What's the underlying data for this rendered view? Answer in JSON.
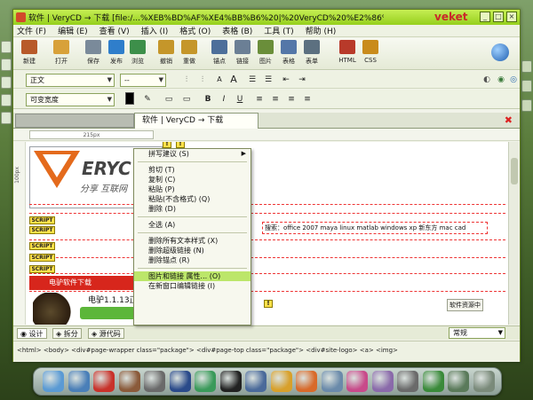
{
  "window": {
    "title": "软件 | VeryCD → 下载 [file:/...%XEB%BD%AF%XE4%BB%B6%20|%20VeryCD%20%E2%86%92%20%E4%B8%8B%...",
    "brand": "veket",
    "controls": {
      "minimize": "_",
      "maximize": "□",
      "close": "×"
    }
  },
  "menubar": {
    "items": [
      "文件 (F)",
      "编辑 (E)",
      "查看 (V)",
      "插入 (I)",
      "格式 (O)",
      "表格 (B)",
      "工具 (T)",
      "帮助 (H)"
    ]
  },
  "toolbar": {
    "buttons": [
      {
        "label": "新建",
        "icon": "new-file-icon",
        "color": "#b85a2a"
      },
      {
        "label": "打开",
        "icon": "open-folder-icon",
        "color": "#d8a13a"
      },
      {
        "label": "保存",
        "icon": "save-icon",
        "color": "#7a8a9a"
      },
      {
        "label": "发布",
        "icon": "publish-icon",
        "color": "#2f7ecb"
      },
      {
        "label": "浏览",
        "icon": "browse-icon",
        "color": "#3d8f4a"
      },
      {
        "label": "撤销",
        "icon": "undo-icon",
        "color": "#c5962a"
      },
      {
        "label": "重做",
        "icon": "redo-icon",
        "color": "#c5962a"
      },
      {
        "label": "锚点",
        "icon": "anchor-icon",
        "color": "#4d6f9a"
      },
      {
        "label": "链接",
        "icon": "link-icon",
        "color": "#6b7f95"
      },
      {
        "label": "图片",
        "icon": "image-icon",
        "color": "#6a8e3a"
      },
      {
        "label": "表格",
        "icon": "table-icon",
        "color": "#5477a8"
      },
      {
        "label": "表单",
        "icon": "form-icon",
        "color": "#5c7080"
      },
      {
        "label": "HTML",
        "icon": "html-icon",
        "color": "#b83a2a"
      },
      {
        "label": "CSS",
        "icon": "css-icon",
        "color": "#c98b1c"
      }
    ]
  },
  "format1": {
    "paragraph_style": "正文",
    "font_size": "--"
  },
  "format2": {
    "font_family": "可变宽度"
  },
  "tabs": {
    "active": "软件 | VeryCD → 下载"
  },
  "ruler": {
    "width_label": "215px"
  },
  "doc": {
    "vruler_label": "100px",
    "logo_text": "ERYC",
    "logo_sub": "分享  互联网",
    "script_tag": "SCRIPT",
    "tag_mark": "!",
    "redbar_text": "电驴软件下载",
    "hot_text": "搜索：office 2007 maya linux matlab windows xp 新东方 mac cad",
    "news_text": "电驴1.1.13正式版",
    "right_tag": "软件资源中"
  },
  "context_menu": {
    "items": [
      {
        "label": "拼写建议 (S)",
        "submenu": true
      },
      {
        "sep": true
      },
      {
        "label": "剪切 (T)"
      },
      {
        "label": "复制 (C)"
      },
      {
        "label": "粘贴 (P)"
      },
      {
        "label": "粘贴(不含格式) (Q)"
      },
      {
        "label": "删除 (D)"
      },
      {
        "sep": true
      },
      {
        "label": "全选 (A)"
      },
      {
        "sep": true
      },
      {
        "label": "删除所有文本样式 (X)"
      },
      {
        "label": "删除超级链接 (N)"
      },
      {
        "label": "删除锚点 (R)"
      },
      {
        "sep": true
      },
      {
        "label": "图片和链接 属性... (O)",
        "highlight": true
      },
      {
        "label": "在新窗口编辑链接 (I)"
      }
    ]
  },
  "viewbar": {
    "design": "设计",
    "split": "拆分",
    "source": "源代码",
    "zoom": "常规"
  },
  "statusbar": {
    "path": "<html>  <body>  <div#page-wrapper class=\"package\">  <div#page-top class=\"package\">  <div#site-logo>  <a>  <img>"
  },
  "dock": {
    "icons": [
      {
        "name": "desktop-icon",
        "color": "#5a9ad4"
      },
      {
        "name": "monitor-icon",
        "color": "#4a7fb8"
      },
      {
        "name": "game-icon",
        "color": "#c8322a"
      },
      {
        "name": "photo-icon",
        "color": "#8a5a3a"
      },
      {
        "name": "cube-icon",
        "color": "#6a6a6a"
      },
      {
        "name": "media-player-icon",
        "color": "#2a4a8a"
      },
      {
        "name": "network-icon",
        "color": "#3a9a5a"
      },
      {
        "name": "chat-icon",
        "color": "#222222"
      },
      {
        "name": "people-icon",
        "color": "#4a6a9a"
      },
      {
        "name": "folder-icon",
        "color": "#d8a02a"
      },
      {
        "name": "calendar-icon",
        "color": "#d86a2a"
      },
      {
        "name": "document-icon",
        "color": "#6a8aaa"
      },
      {
        "name": "paint-icon",
        "color": "#c84a8a"
      },
      {
        "name": "pen-icon",
        "color": "#8a6aaa"
      },
      {
        "name": "archive-icon",
        "color": "#6a6a6a"
      },
      {
        "name": "music-icon",
        "color": "#3a8a3a"
      },
      {
        "name": "settings-icon",
        "color": "#5a7a5a"
      },
      {
        "name": "trash-icon",
        "color": "#7a8a7a"
      }
    ]
  }
}
